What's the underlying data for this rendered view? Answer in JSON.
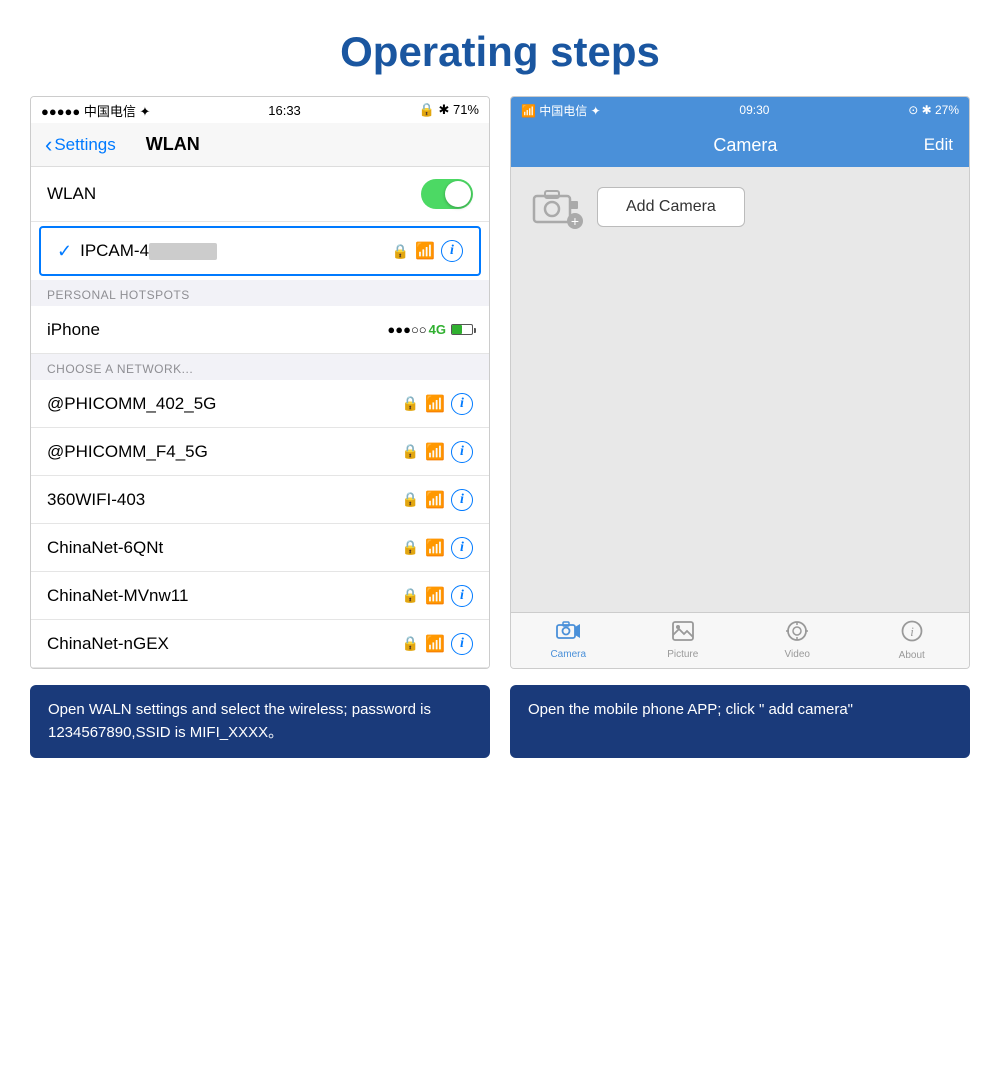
{
  "page": {
    "title": "Operating steps"
  },
  "left_phone": {
    "status_bar": {
      "left": "●●●●● 中国电信 ✦",
      "center": "16:33",
      "right": "🔒 ✱ 71%"
    },
    "nav": {
      "back_label": "Settings",
      "title": "WLAN"
    },
    "wlan_label": "WLAN",
    "connected_network": "IPCAM-4",
    "sections": {
      "hotspots_header": "PERSONAL HOTSPOTS",
      "hotspot_name": "iPhone",
      "choose_header": "CHOOSE A NETWORK...",
      "networks": [
        "@PHICOMM_402_5G",
        "@PHICOMM_F4_5G",
        "360WIFI-403",
        "ChinaNet-6QNt",
        "ChinaNet-MVnw11",
        "ChinaNet-nGEX"
      ]
    },
    "caption": "Open WALN settings and select the wireless; password is 1234567890,SSID is MIFI_XXXX。"
  },
  "right_phone": {
    "status_bar": {
      "left": "📶 中国电信 ✦",
      "center": "09:30",
      "right": "⊙ ✱ 27%"
    },
    "nav": {
      "title": "Camera",
      "edit": "Edit"
    },
    "add_camera_label": "Add Camera",
    "tabs": [
      {
        "label": "Camera",
        "active": true
      },
      {
        "label": "Picture",
        "active": false
      },
      {
        "label": "Video",
        "active": false
      },
      {
        "label": "About",
        "active": false
      }
    ],
    "caption": "Open the mobile phone APP; click \" add camera\""
  }
}
